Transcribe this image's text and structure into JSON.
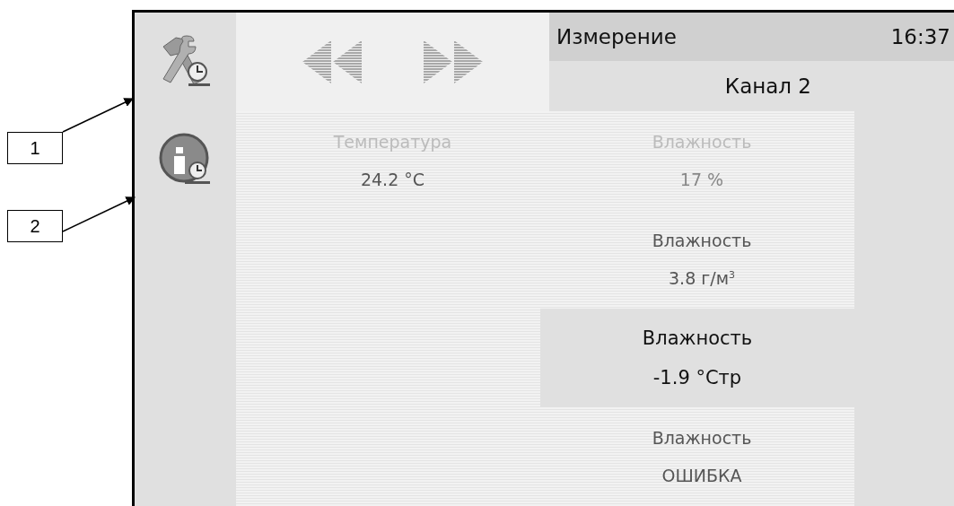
{
  "callouts": [
    {
      "label": "1"
    },
    {
      "label": "2"
    }
  ],
  "sidebar": {
    "items": [
      {
        "kind": "tools"
      },
      {
        "kind": "info"
      }
    ]
  },
  "navigation": {
    "buttons": [
      {
        "kind": "back"
      },
      {
        "kind": "forward"
      }
    ]
  },
  "title_bar": {
    "title": "Измерение",
    "time": "16:37"
  },
  "channel": {
    "label": "Канал 2"
  },
  "readings_left": [
    {
      "label": "Температура",
      "value": "24.2 °C",
      "disabled": true,
      "selected": false
    }
  ],
  "readings_right": [
    {
      "label": "Влажность",
      "value": "17 %",
      "disabled": true,
      "selected": false
    },
    {
      "label": "Влажность",
      "value": "3.8 г/м$^{3}$",
      "disabled": false,
      "selected": false
    },
    {
      "label": "Влажность",
      "value": "-1.9 °Стр",
      "disabled": false,
      "selected": true
    },
    {
      "label": "Влажность",
      "value": "ОШИБКА",
      "disabled": false,
      "selected": false
    }
  ]
}
